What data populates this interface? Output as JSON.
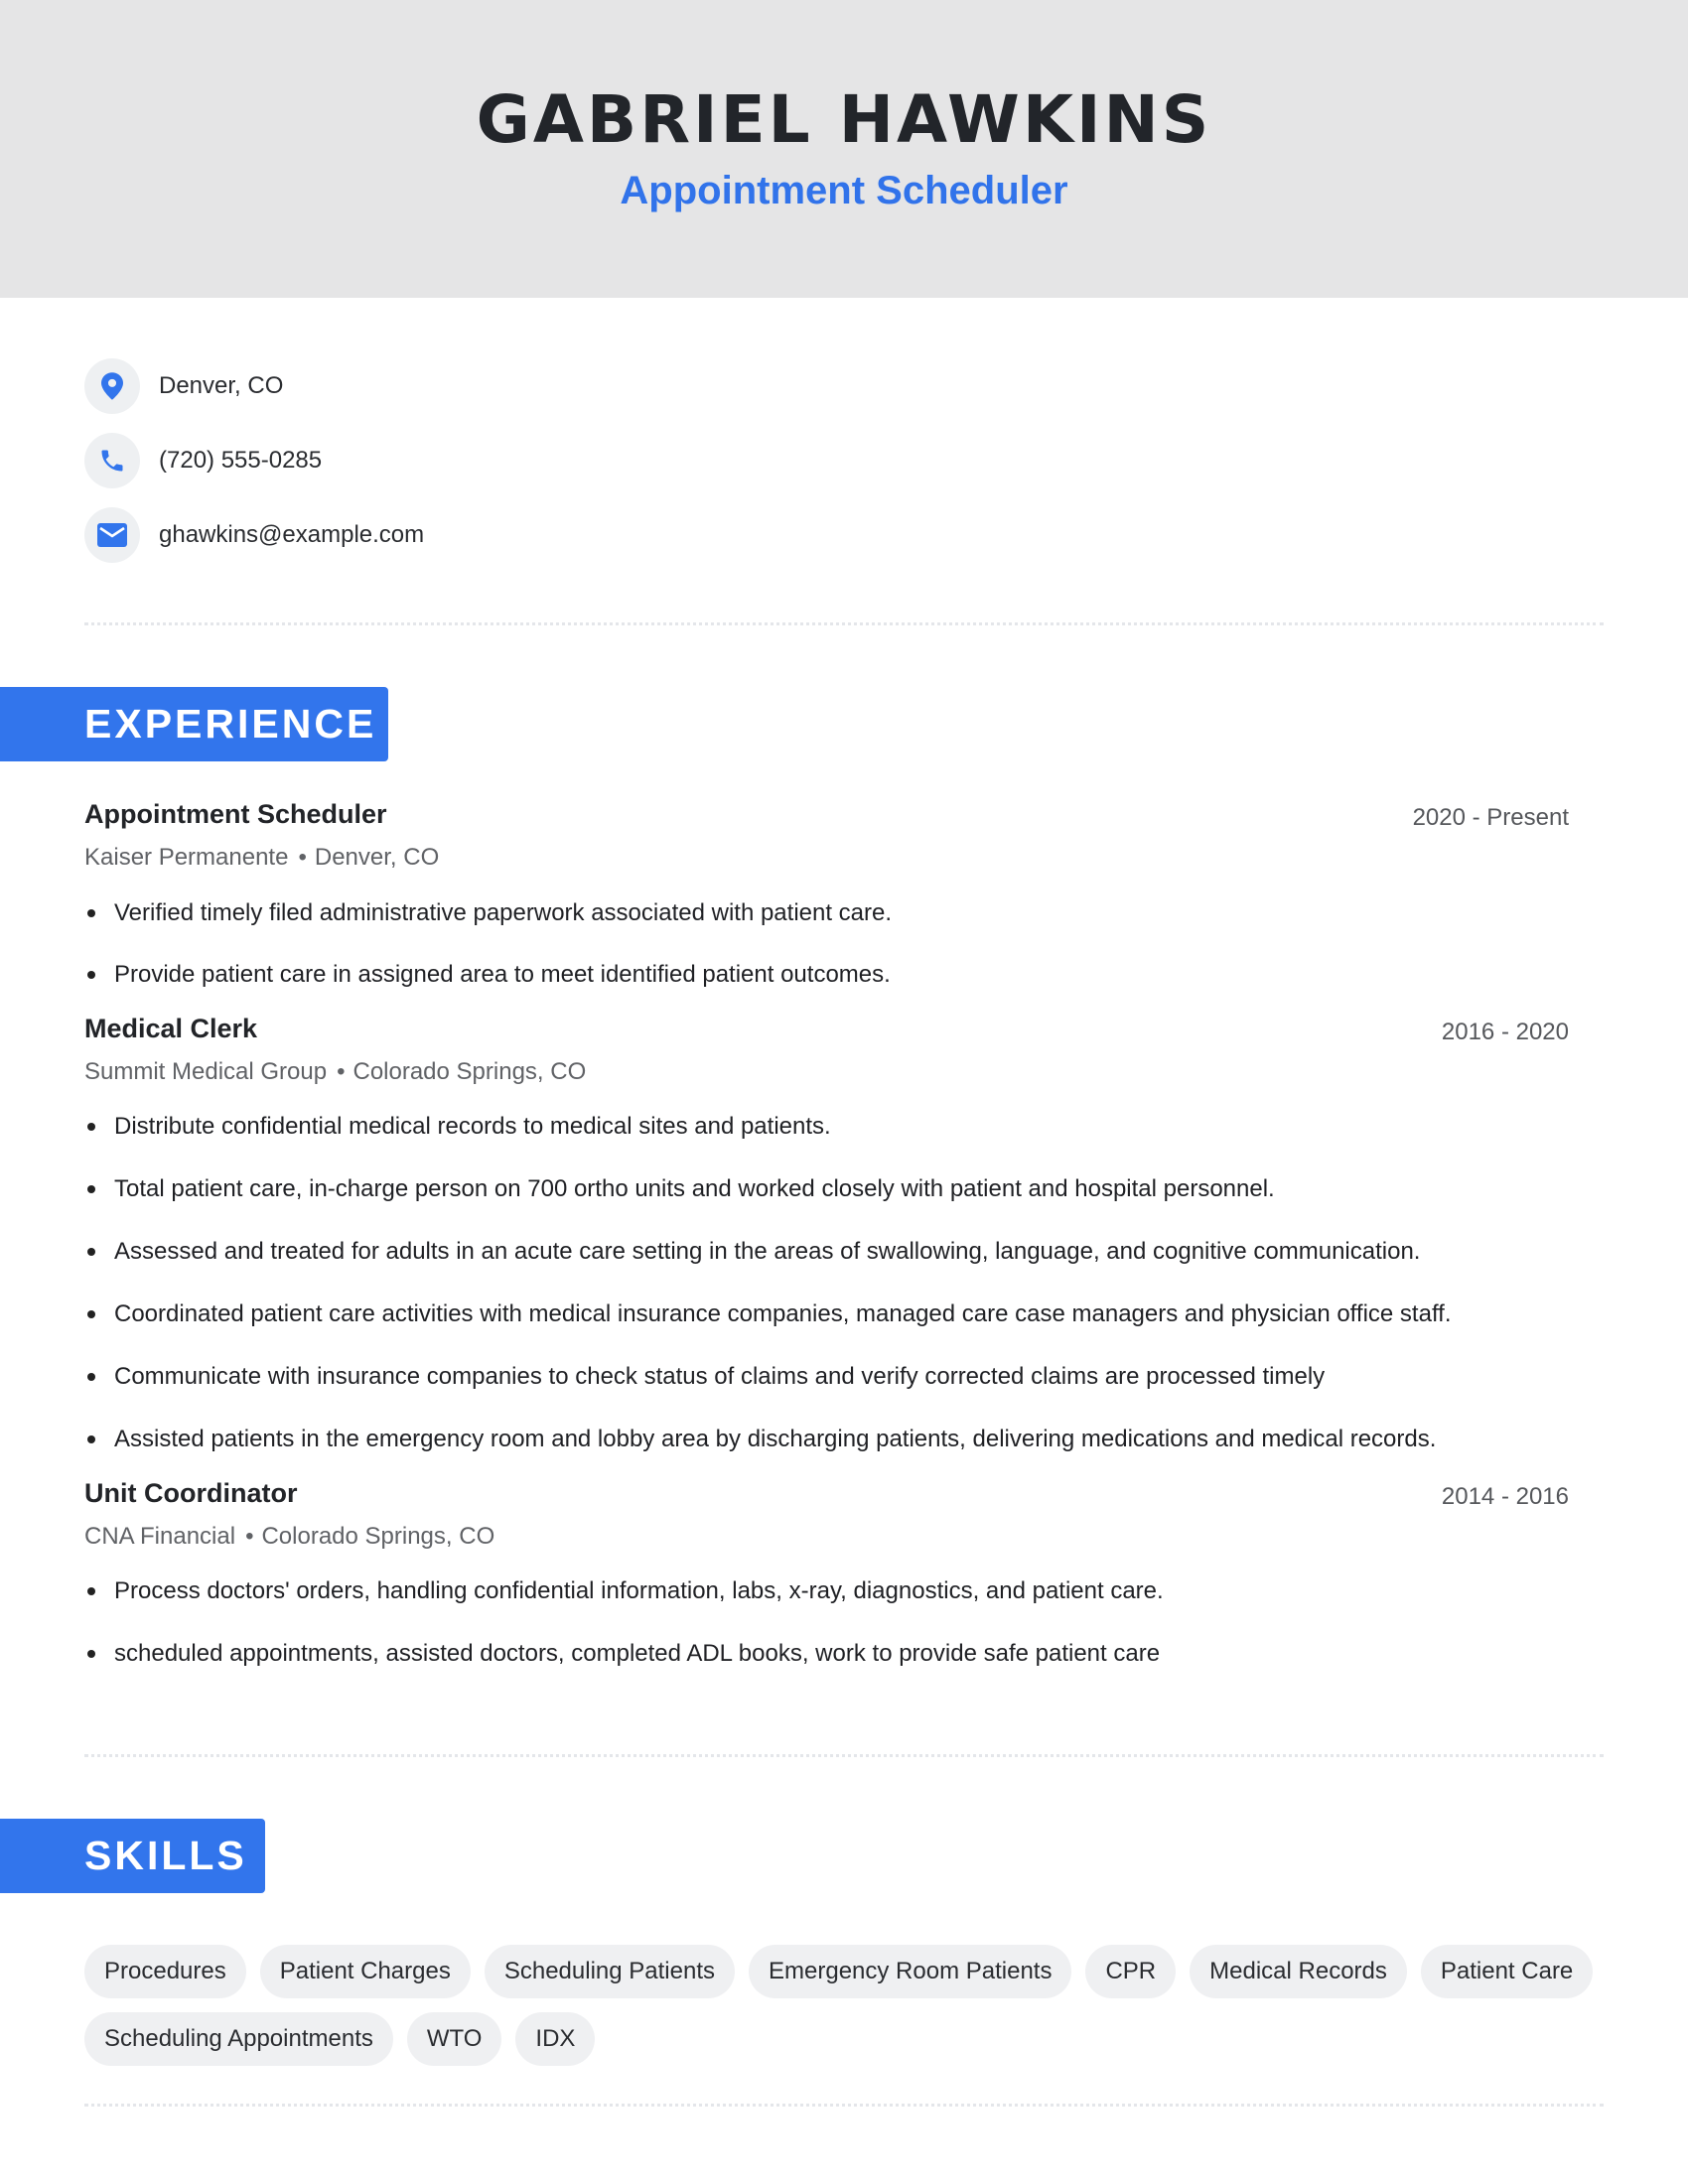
{
  "header": {
    "name": "GABRIEL HAWKINS",
    "role": "Appointment Scheduler"
  },
  "colors": {
    "accent": "#3275ec",
    "header_bg": "#e5e5e6",
    "chip_bg": "#eff0f2",
    "text": "#1f2024"
  },
  "contact": [
    {
      "icon": "location-pin-icon",
      "text": "Denver, CO"
    },
    {
      "icon": "phone-icon",
      "text": "(720) 555-0285"
    },
    {
      "icon": "mail-icon",
      "text": "ghawkins@example.com"
    }
  ],
  "sections": {
    "experience": "EXPERIENCE",
    "skills": "SKILLS"
  },
  "experience": [
    {
      "title": "Appointment Scheduler",
      "dates": "2020 - Present",
      "company": "Kaiser Permanente",
      "location": "Denver, CO",
      "bullets": [
        "Verified timely filed administrative paperwork associated with patient care.",
        "Provide patient care in assigned area to meet identified patient outcomes."
      ]
    },
    {
      "title": "Medical Clerk",
      "dates": "2016 - 2020",
      "company": "Summit Medical Group",
      "location": "Colorado Springs, CO",
      "bullets": [
        "Distribute confidential medical records to medical sites and patients.",
        "Total patient care, in-charge person on 700 ortho units and worked closely with patient and hospital personnel.",
        "Assessed and treated for adults in an acute care setting in the areas of swallowing, language, and cognitive communication.",
        "Coordinated patient care activities with medical insurance companies, managed care case managers and physician office staff.",
        "Communicate with insurance companies to check status of claims and verify corrected claims are processed timely",
        "Assisted patients in the emergency room and lobby area by discharging patients, delivering medications and medical records."
      ]
    },
    {
      "title": "Unit Coordinator",
      "dates": "2014 - 2016",
      "company": "CNA Financial",
      "location": "Colorado Springs, CO",
      "bullets": [
        "Process doctors' orders, handling confidential information, labs, x-ray, diagnostics, and patient care.",
        "scheduled appointments, assisted doctors, completed ADL books, work to provide safe patient care"
      ]
    }
  ],
  "skills": [
    "Procedures",
    "Patient Charges",
    "Scheduling Patients",
    "Emergency Room Patients",
    "CPR",
    "Medical Records",
    "Patient Care",
    "Scheduling Appointments",
    "WTO",
    "IDX"
  ],
  "separator": "•"
}
